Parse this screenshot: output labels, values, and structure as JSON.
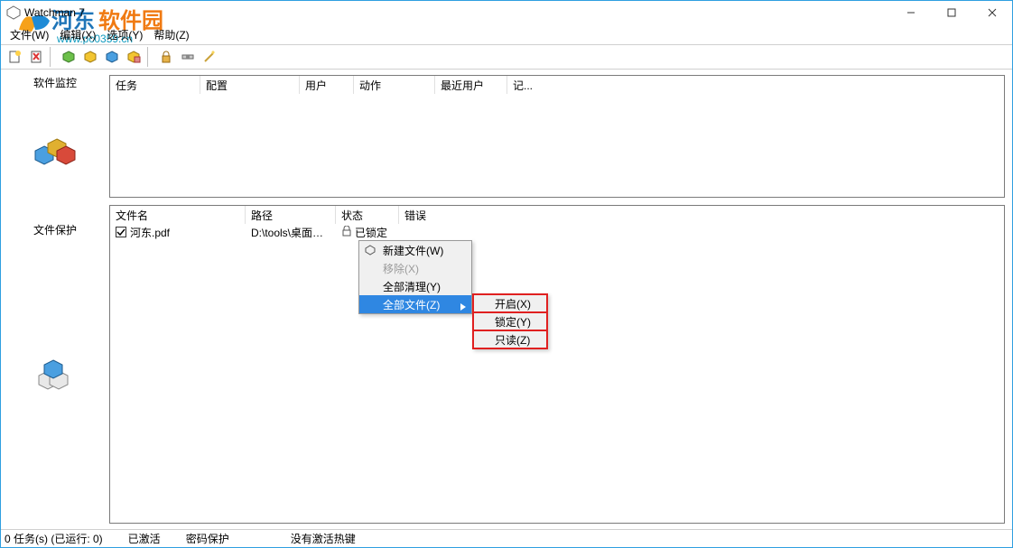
{
  "window": {
    "title": "Watchman 7"
  },
  "watermark": {
    "text_pre": "河东",
    "text_post": "软件园",
    "url": "www.pc0359.cn"
  },
  "menubar": {
    "file": "文件(W)",
    "edit": "编辑(X)",
    "options": "选项(Y)",
    "help": "帮助(Z)"
  },
  "sidebar": {
    "software_monitor": "软件监控",
    "file_protect": "文件保护"
  },
  "top_pane": {
    "cols": {
      "task": "任务",
      "config": "配置",
      "user": "用户",
      "action": "动作",
      "recent_user": "最近用户",
      "record": "记..."
    }
  },
  "bottom_pane": {
    "cols": {
      "name": "文件名",
      "path": "路径",
      "status": "状态",
      "error": "错误"
    },
    "rows": [
      {
        "checked": true,
        "name": "河东.pdf",
        "path": "D:\\tools\\桌面…",
        "status": "已锁定",
        "status_icon": "lock"
      }
    ]
  },
  "context_menu": {
    "new_file": "新建文件(W)",
    "remove": "移除(X)",
    "clear_all": "全部清理(Y)",
    "all_files": "全部文件(Z)",
    "submenu": {
      "open": "开启(X)",
      "lock": "锁定(Y)",
      "readonly": "只读(Z)"
    }
  },
  "statusbar": {
    "tasks": "0 任务(s) (已运行: 0)",
    "activated": "已激活",
    "pwd_protect": "密码保护",
    "no_hotkey": "没有激活热键"
  }
}
